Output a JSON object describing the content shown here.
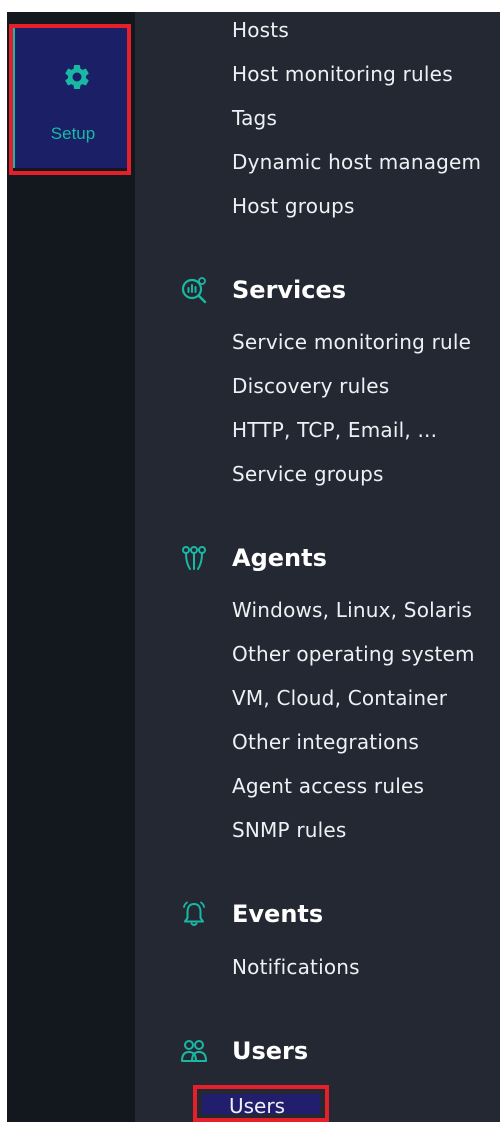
{
  "rail": {
    "setup": {
      "label": "Setup",
      "icon": "gear-icon",
      "color": "#18b9a6"
    }
  },
  "menu": {
    "hosts_items": [
      "Hosts",
      "Host monitoring rules",
      "Tags",
      "Dynamic host managem",
      "Host groups"
    ],
    "services": {
      "title": "Services",
      "icon": "services-icon",
      "items": [
        "Service monitoring rule",
        "Discovery rules",
        "HTTP, TCP, Email, ...",
        "Service groups"
      ]
    },
    "agents": {
      "title": "Agents",
      "icon": "agents-icon",
      "items": [
        "Windows, Linux, Solaris",
        "Other operating system",
        "VM, Cloud, Container",
        "Other integrations",
        "Agent access rules",
        "SNMP rules"
      ]
    },
    "events": {
      "title": "Events",
      "icon": "bell-icon",
      "items": [
        "Notifications"
      ]
    },
    "users": {
      "title": "Users",
      "icon": "users-icon",
      "items": [
        "Users"
      ]
    }
  },
  "colors": {
    "accent": "#18b9a6",
    "highlight": "#e5202a",
    "selected_bg": "#211e6e"
  }
}
